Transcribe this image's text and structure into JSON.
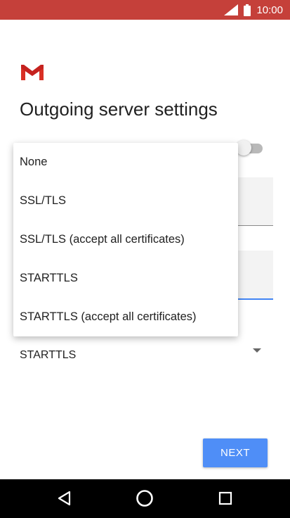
{
  "status_bar": {
    "time": "10:00",
    "background": "#c5403a",
    "icons": [
      "signal-icon",
      "battery-icon"
    ]
  },
  "logo": {
    "icon": "gmail-logo"
  },
  "header": {
    "title": "Outgoing server settings"
  },
  "toggle": {
    "state": "off"
  },
  "dropdown": {
    "options": [
      "None",
      "SSL/TLS",
      "SSL/TLS (accept all certificates)",
      "STARTTLS",
      "STARTTLS (accept all certificates)"
    ]
  },
  "security_select": {
    "value": "STARTTLS"
  },
  "footer": {
    "next_label": "NEXT",
    "next_color": "#4f8ef7"
  },
  "nav_bar": {
    "buttons": [
      "back-icon",
      "home-icon",
      "recents-icon"
    ]
  }
}
